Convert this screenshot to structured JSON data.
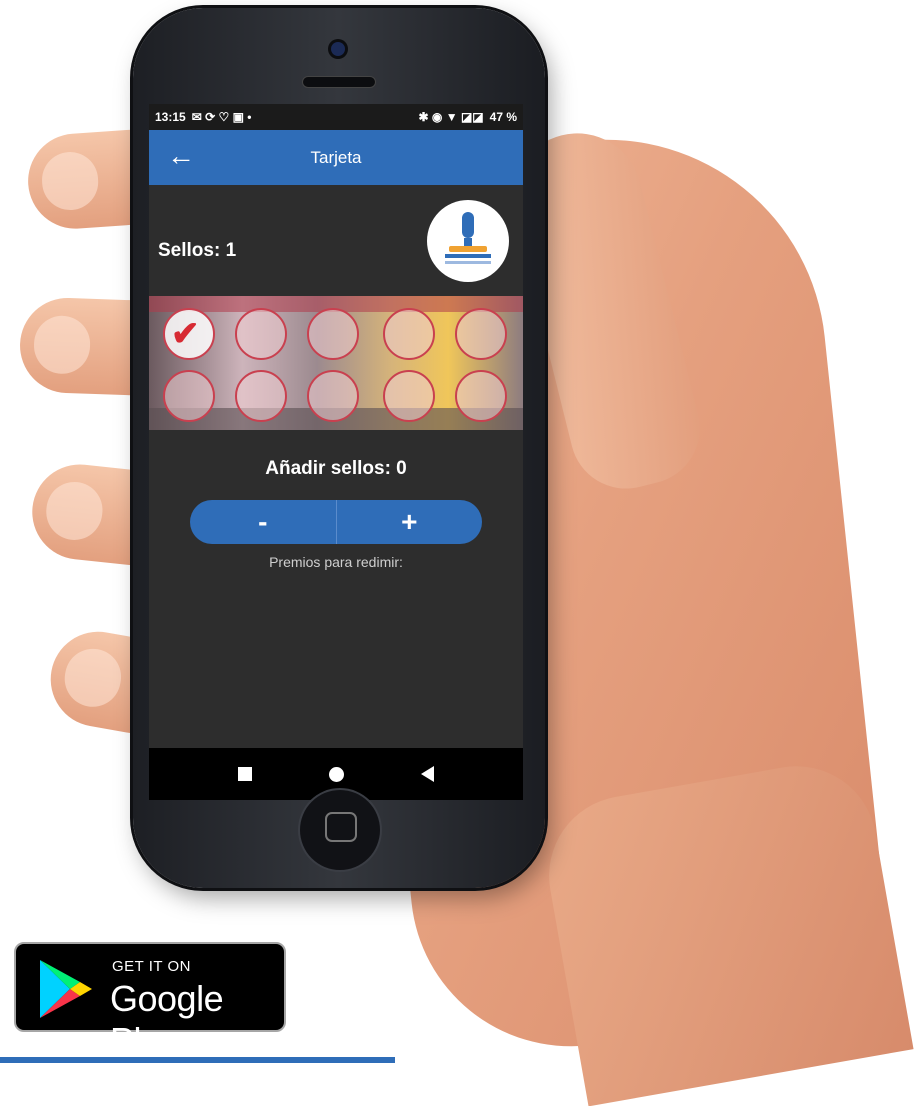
{
  "status_bar": {
    "time": "13:15",
    "left_icons": "✉ ⟳ ♡ ▣ •",
    "right_icons": "✱ ◉ ▼ ◪◪",
    "battery": "47 %"
  },
  "app_bar": {
    "back_icon": "arrow-left-icon",
    "title": "Tarjeta"
  },
  "stamps": {
    "label": "Sellos: 1",
    "count": 1,
    "total_slots": 10
  },
  "add_stamps": {
    "label": "Añadir sellos: 0",
    "minus": "-",
    "plus": "+"
  },
  "prizes": {
    "label": "Premios para redimir:"
  },
  "badge": {
    "small": "GET IT ON",
    "big": "Google Play"
  },
  "colors": {
    "accent": "#2f6db8",
    "background": "#2d2d2d",
    "stamp_red": "#d72a33"
  }
}
